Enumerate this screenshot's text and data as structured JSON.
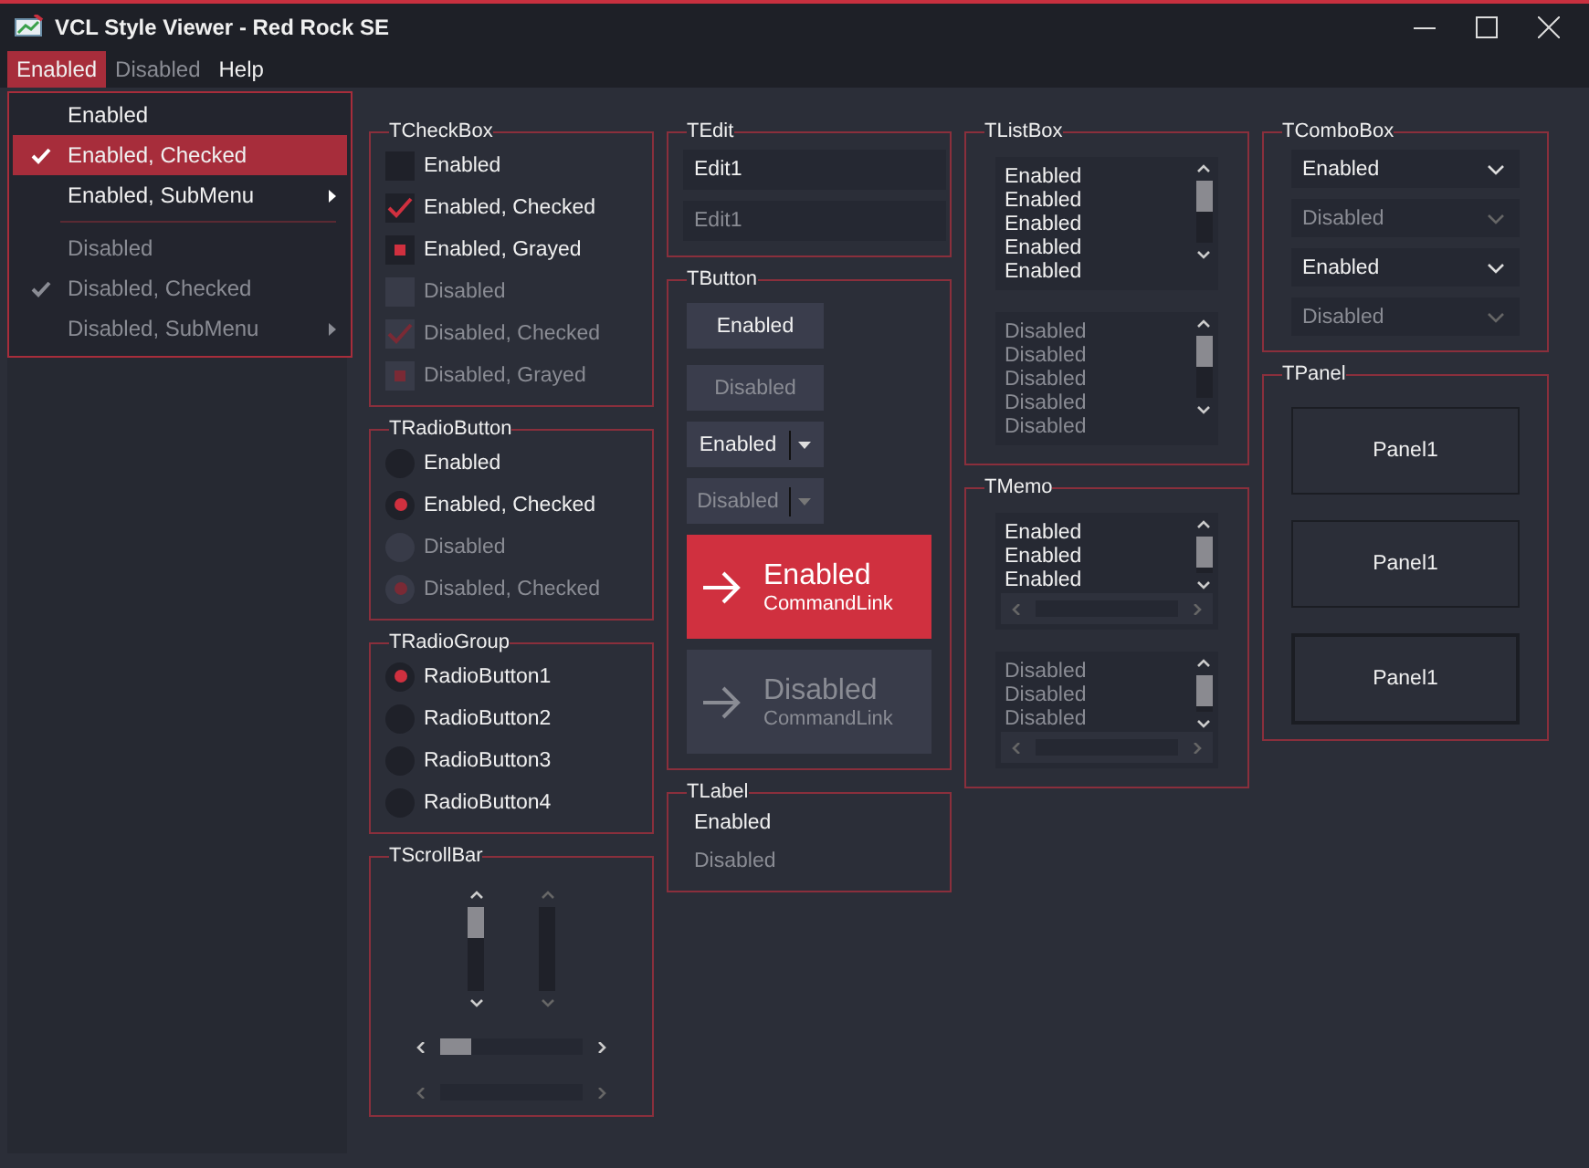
{
  "window": {
    "title": "VCL Style Viewer - Red Rock SE"
  },
  "menu_bar": [
    {
      "label": "Enabled",
      "selected": true,
      "disabled": false
    },
    {
      "label": "Disabled",
      "selected": false,
      "disabled": true
    },
    {
      "label": "Help",
      "selected": false,
      "disabled": false
    }
  ],
  "dropdown_menu": [
    {
      "kind": "item",
      "label": "Enabled",
      "checked": false,
      "disabled": false,
      "submenu": false,
      "selected": false
    },
    {
      "kind": "item",
      "label": "Enabled, Checked",
      "checked": true,
      "disabled": false,
      "submenu": false,
      "selected": true
    },
    {
      "kind": "item",
      "label": "Enabled, SubMenu",
      "checked": false,
      "disabled": false,
      "submenu": true,
      "selected": false
    },
    {
      "kind": "separator"
    },
    {
      "kind": "item",
      "label": "Disabled",
      "checked": false,
      "disabled": true,
      "submenu": false,
      "selected": false
    },
    {
      "kind": "item",
      "label": "Disabled, Checked",
      "checked": true,
      "disabled": true,
      "submenu": false,
      "selected": false
    },
    {
      "kind": "item",
      "label": "Disabled, SubMenu",
      "checked": false,
      "disabled": true,
      "submenu": true,
      "selected": false
    }
  ],
  "columns": [
    [
      {
        "kind": "checkbox",
        "title": "TCheckBox",
        "items": [
          {
            "label": "Enabled",
            "checked": false,
            "grayed": false,
            "disabled": false
          },
          {
            "label": "Enabled, Checked",
            "checked": true,
            "grayed": false,
            "disabled": false
          },
          {
            "label": "Enabled, Grayed",
            "checked": false,
            "grayed": true,
            "disabled": false
          },
          {
            "label": "Disabled",
            "checked": false,
            "grayed": false,
            "disabled": true
          },
          {
            "label": "Disabled, Checked",
            "checked": true,
            "grayed": false,
            "disabled": true
          },
          {
            "label": "Disabled, Grayed",
            "checked": false,
            "grayed": true,
            "disabled": true
          }
        ]
      },
      {
        "kind": "radio",
        "title": "TRadioButton",
        "items": [
          {
            "label": "Enabled",
            "checked": false,
            "disabled": false
          },
          {
            "label": "Enabled, Checked",
            "checked": true,
            "disabled": false
          },
          {
            "label": "Disabled",
            "checked": false,
            "disabled": true
          },
          {
            "label": "Disabled, Checked",
            "checked": true,
            "disabled": true
          }
        ]
      },
      {
        "kind": "radiogroup",
        "title": "TRadioGroup",
        "items": [
          {
            "label": "RadioButton1",
            "selected": true
          },
          {
            "label": "RadioButton2",
            "selected": false
          },
          {
            "label": "RadioButton3",
            "selected": false
          },
          {
            "label": "RadioButton4",
            "selected": false
          }
        ]
      },
      {
        "kind": "scrollbar",
        "title": "TScrollBar",
        "items": [
          {
            "kind": "vertical",
            "disabled": false
          },
          {
            "kind": "vertical",
            "disabled": true
          },
          {
            "kind": "horizontal",
            "disabled": false
          },
          {
            "kind": "horizontal",
            "disabled": true
          }
        ]
      }
    ],
    [
      {
        "kind": "edit",
        "title": "TEdit",
        "items": [
          {
            "value": "Edit1",
            "disabled": false
          },
          {
            "value": "Edit1",
            "disabled": true
          }
        ]
      },
      {
        "kind": "button",
        "title": "TButton",
        "items": [
          {
            "kind": "push",
            "label": "Enabled",
            "disabled": false
          },
          {
            "kind": "push",
            "label": "Disabled",
            "disabled": true
          },
          {
            "kind": "split",
            "label": "Enabled",
            "disabled": false
          },
          {
            "kind": "split",
            "label": "Disabled",
            "disabled": true
          },
          {
            "kind": "commandlink",
            "label": "Enabled",
            "note": "CommandLink",
            "disabled": false
          },
          {
            "kind": "commandlink",
            "label": "Disabled",
            "note": "CommandLink",
            "disabled": true
          }
        ]
      },
      {
        "kind": "label",
        "title": "TLabel",
        "items": [
          {
            "text": "Enabled",
            "disabled": false
          },
          {
            "text": "Disabled",
            "disabled": true
          }
        ]
      }
    ],
    [
      {
        "kind": "listbox",
        "title": "TListBox",
        "items": [
          {
            "lines": [
              "Enabled",
              "Enabled",
              "Enabled",
              "Enabled",
              "Enabled"
            ],
            "disabled": false
          },
          {
            "lines": [
              "Disabled",
              "Disabled",
              "Disabled",
              "Disabled",
              "Disabled"
            ],
            "disabled": true
          }
        ]
      },
      {
        "kind": "memo",
        "title": "TMemo",
        "items": [
          {
            "lines": [
              "Enabled",
              "Enabled",
              "Enabled"
            ],
            "disabled": false
          },
          {
            "lines": [
              "Disabled",
              "Disabled",
              "Disabled"
            ],
            "disabled": true
          }
        ]
      }
    ],
    [
      {
        "kind": "combobox",
        "title": "TComboBox",
        "items": [
          {
            "value": "Enabled",
            "disabled": false
          },
          {
            "value": "Disabled",
            "disabled": true
          },
          {
            "value": "Enabled",
            "disabled": false
          },
          {
            "value": "Disabled",
            "disabled": true
          }
        ]
      },
      {
        "kind": "panel",
        "title": "TPanel",
        "items": [
          {
            "label": "Panel1",
            "thick_border": false
          },
          {
            "label": "Panel1",
            "thick_border": false
          },
          {
            "label": "Panel1",
            "thick_border": true
          }
        ]
      }
    ]
  ]
}
